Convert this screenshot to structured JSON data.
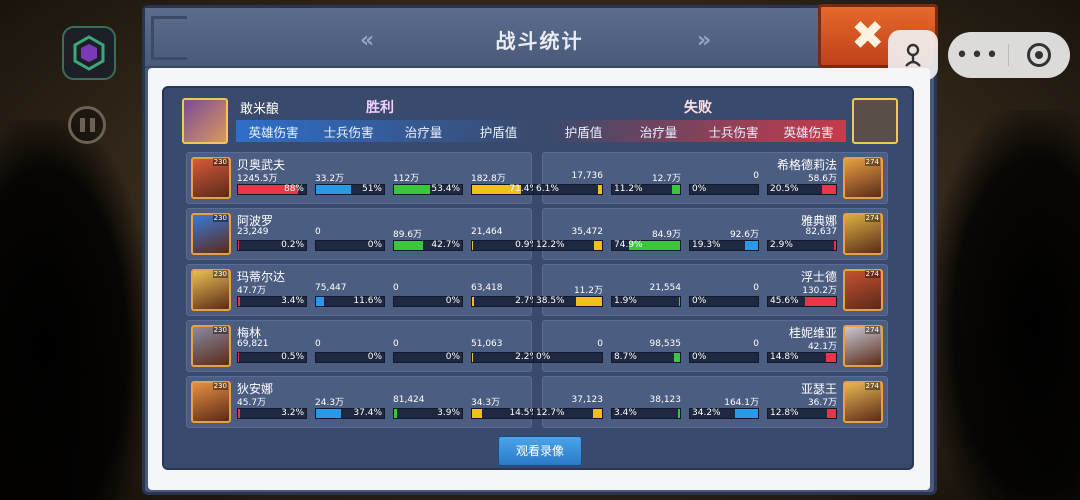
{
  "window": {
    "title": "战斗统计"
  },
  "nav": {
    "prev": "«",
    "next": "»"
  },
  "close_symbol": "✖",
  "capsule": {
    "more": "•••"
  },
  "player": {
    "name": "敢米酿",
    "result_left": "胜利",
    "result_right": "失败"
  },
  "tabs_left": [
    "英雄伤害",
    "士兵伤害",
    "治疗量",
    "护盾值"
  ],
  "tabs_right": [
    "护盾值",
    "治疗量",
    "士兵伤害",
    "英雄伤害"
  ],
  "colors": {
    "hero_damage": "#e8354a",
    "soldier_damage": "#2a9ae8",
    "healing": "#3ac83a",
    "shield": "#f0c020"
  },
  "left_heroes": [
    {
      "name": "贝奥武夫",
      "level": "230",
      "stats": [
        {
          "value": "1245.5万",
          "pct": "88%",
          "fill": 0.88
        },
        {
          "value": "33.2万",
          "pct": "51%",
          "fill": 0.51
        },
        {
          "value": "112万",
          "pct": "53.4%",
          "fill": 0.534
        },
        {
          "value": "182.8万",
          "pct": "71.4%",
          "fill": 0.714
        }
      ]
    },
    {
      "name": "阿波罗",
      "level": "230",
      "stats": [
        {
          "value": "23,249",
          "pct": "0.2%",
          "fill": 0.002
        },
        {
          "value": "0",
          "pct": "0%",
          "fill": 0
        },
        {
          "value": "89.6万",
          "pct": "42.7%",
          "fill": 0.427
        },
        {
          "value": "21,464",
          "pct": "0.9%",
          "fill": 0.009
        }
      ]
    },
    {
      "name": "玛蒂尔达",
      "level": "230",
      "stats": [
        {
          "value": "47.7万",
          "pct": "3.4%",
          "fill": 0.034
        },
        {
          "value": "75,447",
          "pct": "11.6%",
          "fill": 0.116
        },
        {
          "value": "0",
          "pct": "0%",
          "fill": 0
        },
        {
          "value": "63,418",
          "pct": "2.7%",
          "fill": 0.027
        }
      ]
    },
    {
      "name": "梅林",
      "level": "230",
      "stats": [
        {
          "value": "69,821",
          "pct": "0.5%",
          "fill": 0.005
        },
        {
          "value": "0",
          "pct": "0%",
          "fill": 0
        },
        {
          "value": "0",
          "pct": "0%",
          "fill": 0
        },
        {
          "value": "51,063",
          "pct": "2.2%",
          "fill": 0.022
        }
      ]
    },
    {
      "name": "狄安娜",
      "level": "230",
      "stats": [
        {
          "value": "45.7万",
          "pct": "3.2%",
          "fill": 0.032
        },
        {
          "value": "24.3万",
          "pct": "37.4%",
          "fill": 0.374
        },
        {
          "value": "81,424",
          "pct": "3.9%",
          "fill": 0.039
        },
        {
          "value": "34.3万",
          "pct": "14.5%",
          "fill": 0.145
        }
      ]
    }
  ],
  "right_heroes": [
    {
      "name": "希格德莉法",
      "level": "274",
      "stats": [
        {
          "value": "17,736",
          "pct": "6.1%",
          "fill": 0.061
        },
        {
          "value": "12.7万",
          "pct": "11.2%",
          "fill": 0.112
        },
        {
          "value": "0",
          "pct": "0%",
          "fill": 0
        },
        {
          "value": "58.6万",
          "pct": "20.5%",
          "fill": 0.205
        }
      ]
    },
    {
      "name": "雅典娜",
      "level": "274",
      "stats": [
        {
          "value": "35,472",
          "pct": "12.2%",
          "fill": 0.122
        },
        {
          "value": "84.9万",
          "pct": "74.9%",
          "fill": 0.749
        },
        {
          "value": "92.6万",
          "pct": "19.3%",
          "fill": 0.193
        },
        {
          "value": "82,637",
          "pct": "2.9%",
          "fill": 0.029
        }
      ]
    },
    {
      "name": "浮士德",
      "level": "274",
      "stats": [
        {
          "value": "11.2万",
          "pct": "38.5%",
          "fill": 0.385
        },
        {
          "value": "21,554",
          "pct": "1.9%",
          "fill": 0.019
        },
        {
          "value": "0",
          "pct": "0%",
          "fill": 0
        },
        {
          "value": "130.2万",
          "pct": "45.6%",
          "fill": 0.456
        }
      ]
    },
    {
      "name": "桂妮维亚",
      "level": "274",
      "stats": [
        {
          "value": "0",
          "pct": "0%",
          "fill": 0
        },
        {
          "value": "98,535",
          "pct": "8.7%",
          "fill": 0.087
        },
        {
          "value": "0",
          "pct": "0%",
          "fill": 0
        },
        {
          "value": "42.1万",
          "pct": "14.8%",
          "fill": 0.148
        }
      ]
    },
    {
      "name": "亚瑟王",
      "level": "274",
      "stats": [
        {
          "value": "37,123",
          "pct": "12.7%",
          "fill": 0.127
        },
        {
          "value": "38,123",
          "pct": "3.4%",
          "fill": 0.034
        },
        {
          "value": "164.1万",
          "pct": "34.2%",
          "fill": 0.342
        },
        {
          "value": "36.7万",
          "pct": "12.8%",
          "fill": 0.128
        }
      ]
    }
  ],
  "replay_button": "观看录像"
}
